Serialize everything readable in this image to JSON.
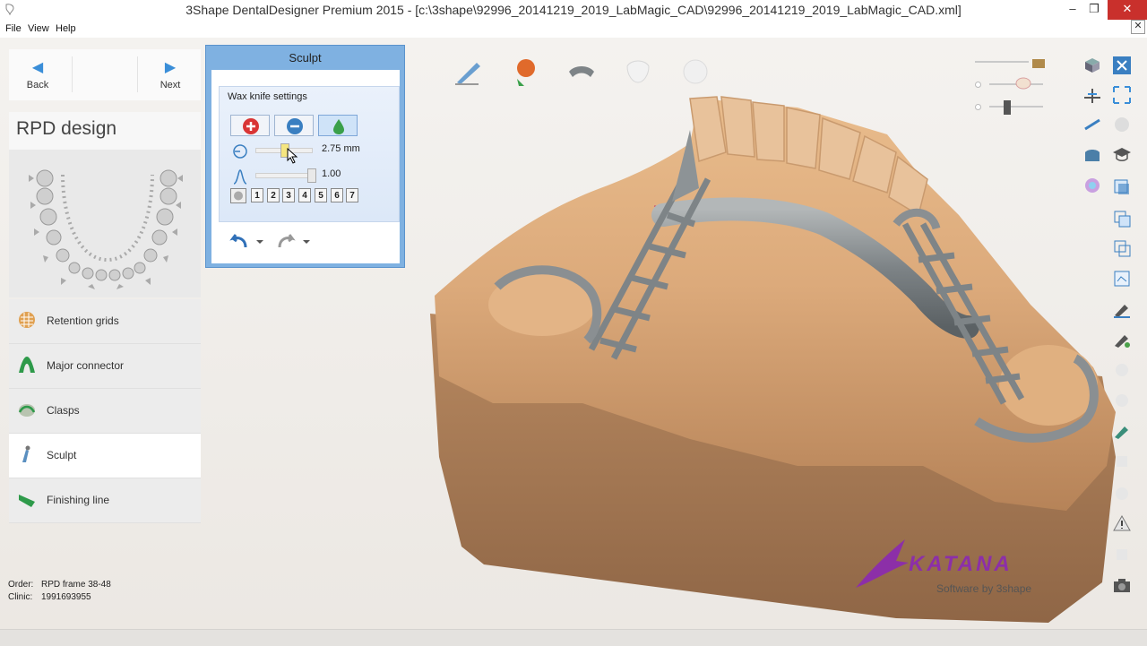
{
  "window": {
    "title": "3Shape DentalDesigner Premium 2015 - [c:\\3shape\\92996_20141219_2019_LabMagic_CAD\\92996_20141219_2019_LabMagic_CAD.xml]",
    "minimize": "–",
    "maximize": "❐",
    "close": "✕"
  },
  "menu": {
    "items": [
      "File",
      "View",
      "Help"
    ],
    "close_doc": "✕"
  },
  "nav": {
    "back_label": "Back",
    "next_label": "Next",
    "back_icon": "arrow-left-icon",
    "next_icon": "arrow-right-icon"
  },
  "step": {
    "title": "RPD design"
  },
  "steps": [
    {
      "label": "Retention grids",
      "icon": "retention-grid-icon",
      "active": false
    },
    {
      "label": "Major connector",
      "icon": "major-connector-icon",
      "active": false
    },
    {
      "label": "Clasps",
      "icon": "clasp-icon",
      "active": false
    },
    {
      "label": "Sculpt",
      "icon": "wax-knife-icon",
      "active": true
    },
    {
      "label": "Finishing line",
      "icon": "finishing-line-icon",
      "active": false
    }
  ],
  "info": {
    "order_label": "Order:",
    "order_value": "RPD frame 38-48",
    "clinic_label": "Clinic:",
    "clinic_value": "1991693955"
  },
  "sculpt": {
    "title": "Sculpt",
    "settings_title": "Wax knife settings",
    "tools": [
      "add-wax-icon",
      "remove-wax-icon",
      "smooth-wax-icon"
    ],
    "size_value": "2.75 mm",
    "size_fraction": 0.5,
    "strength_value": "1.00",
    "strength_fraction": 1.0,
    "levels": [
      "1",
      "2",
      "3",
      "4",
      "5",
      "6",
      "7"
    ]
  },
  "colors": {
    "accent": "#3a8ed8",
    "panel_header": "#7fb1e1",
    "close_red": "#c9302c",
    "metal": "#8a8f92",
    "stone": "#d9a878",
    "katana": "#8c2fa8"
  },
  "logo": {
    "brand": "KATANA",
    "tagline": "Software by 3shape"
  }
}
